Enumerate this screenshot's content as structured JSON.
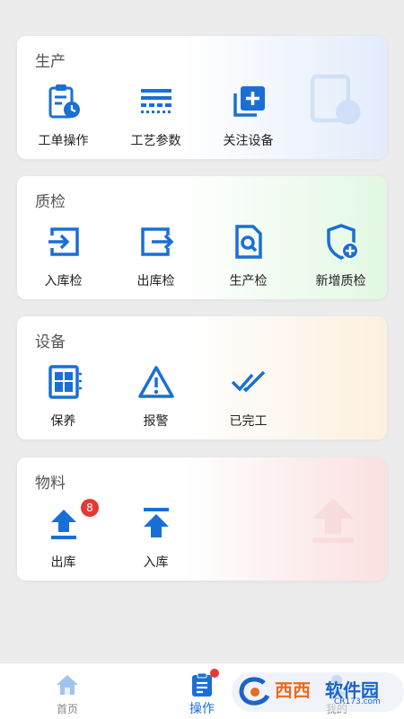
{
  "colors": {
    "accent": "#1a6fd6",
    "badge": "#e53935"
  },
  "sections": [
    {
      "title": "生产",
      "items": [
        {
          "label": "工单操作",
          "icon": "clipboard-clock-icon"
        },
        {
          "label": "工艺参数",
          "icon": "process-lines-icon"
        },
        {
          "label": "关注设备",
          "icon": "add-copy-icon"
        }
      ]
    },
    {
      "title": "质检",
      "items": [
        {
          "label": "入库检",
          "icon": "enter-icon"
        },
        {
          "label": "出库检",
          "icon": "exit-icon"
        },
        {
          "label": "生产检",
          "icon": "document-search-icon"
        },
        {
          "label": "新增质检",
          "icon": "shield-add-icon"
        }
      ]
    },
    {
      "title": "设备",
      "items": [
        {
          "label": "保养",
          "icon": "chip-icon"
        },
        {
          "label": "报警",
          "icon": "warning-icon"
        },
        {
          "label": "已完工",
          "icon": "double-check-icon"
        }
      ]
    },
    {
      "title": "物料",
      "items": [
        {
          "label": "出库",
          "icon": "upload-icon",
          "badge": "8"
        },
        {
          "label": "入库",
          "icon": "top-upload-icon"
        }
      ]
    }
  ],
  "nav": [
    {
      "label": "首页",
      "icon": "home-icon"
    },
    {
      "label": "操作",
      "icon": "clipboard-icon"
    },
    {
      "label": "我的",
      "icon": "user-icon"
    }
  ],
  "watermark": {
    "name_a": "西西",
    "name_b": "软件园",
    "url": "CR173.com"
  }
}
